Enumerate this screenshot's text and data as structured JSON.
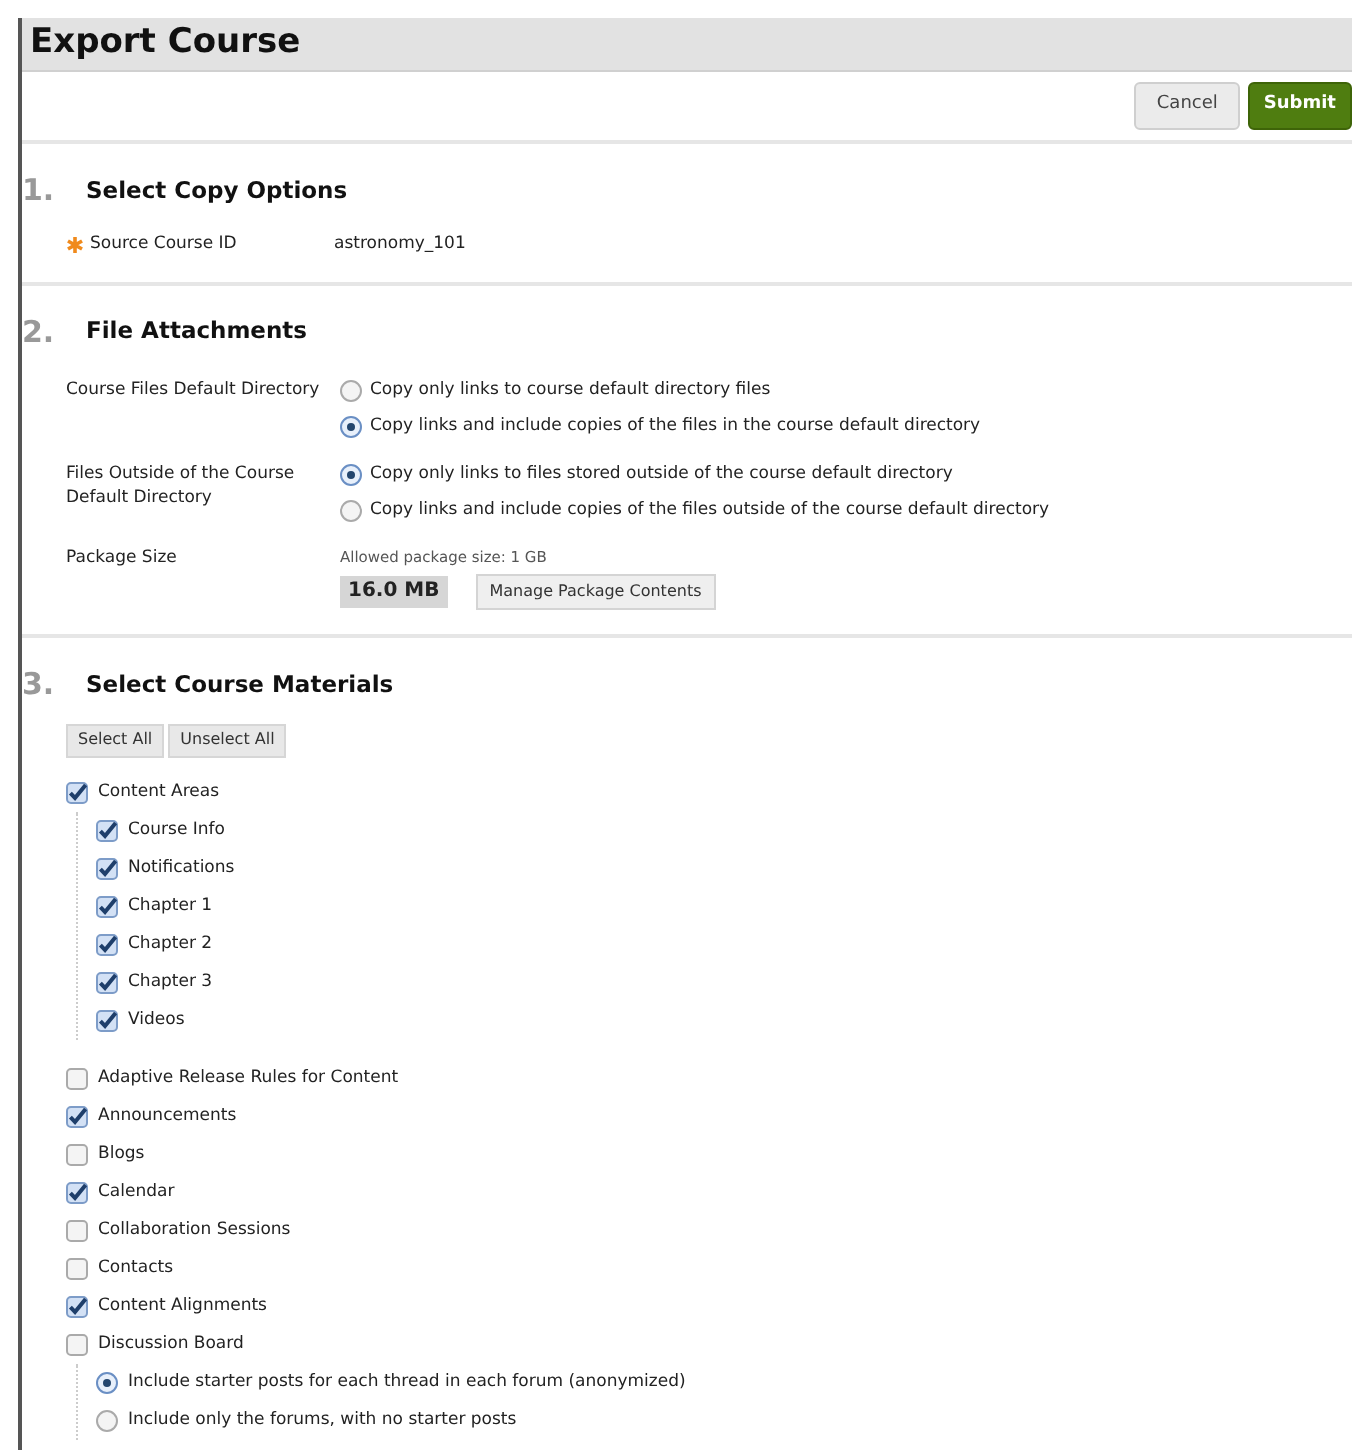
{
  "title": "Export Course",
  "buttons": [
    {
      "label": "Cancel",
      "kind": "secondary"
    },
    {
      "label": "Submit",
      "kind": "primary"
    }
  ],
  "sections": [
    {
      "number": "1.",
      "title": "Select Copy Options",
      "kind": "fields",
      "fields": [
        {
          "label": "Source Course ID",
          "value": "astronomy_101",
          "required": true
        }
      ]
    },
    {
      "number": "2.",
      "title": "File Attachments",
      "kind": "attachments",
      "groups": [
        {
          "label": "Course Files Default Directory",
          "options": [
            {
              "label": "Copy only links to course default directory files",
              "selected": false
            },
            {
              "label": "Copy links and include copies of the files in the course default directory",
              "selected": true
            }
          ]
        },
        {
          "label": "Files Outside of the Course Default Directory",
          "options": [
            {
              "label": "Copy only links to files stored outside of the course default directory",
              "selected": true
            },
            {
              "label": "Copy links and include copies of the files outside of the course default directory",
              "selected": false
            }
          ]
        }
      ],
      "package": {
        "label": "Package Size",
        "allowed": "Allowed package size:  1 GB",
        "size": "16.0 MB",
        "button": "Manage Package Contents"
      }
    },
    {
      "number": "3.",
      "title": "Select Course Materials",
      "kind": "materials",
      "buttons": [
        "Select All",
        "Unselect All"
      ],
      "items": [
        {
          "kind": "checkbox",
          "label": "Content Areas",
          "checked": true,
          "children": [
            {
              "kind": "checkbox",
              "label": "Course Info",
              "checked": true
            },
            {
              "kind": "checkbox",
              "label": "Notifications",
              "checked": true
            },
            {
              "kind": "checkbox",
              "label": "Chapter 1",
              "checked": true
            },
            {
              "kind": "checkbox",
              "label": "Chapter 2",
              "checked": true
            },
            {
              "kind": "checkbox",
              "label": "Chapter 3",
              "checked": true
            },
            {
              "kind": "checkbox",
              "label": "Videos",
              "checked": true
            }
          ]
        },
        {
          "kind": "checkbox",
          "label": "Adaptive Release Rules for Content",
          "checked": false
        },
        {
          "kind": "checkbox",
          "label": "Announcements",
          "checked": true
        },
        {
          "kind": "checkbox",
          "label": "Blogs",
          "checked": false
        },
        {
          "kind": "checkbox",
          "label": "Calendar",
          "checked": true
        },
        {
          "kind": "checkbox",
          "label": "Collaboration Sessions",
          "checked": false
        },
        {
          "kind": "checkbox",
          "label": "Contacts",
          "checked": false
        },
        {
          "kind": "checkbox",
          "label": "Content Alignments",
          "checked": true
        },
        {
          "kind": "checkbox",
          "label": "Discussion Board",
          "checked": false,
          "children": [
            {
              "kind": "radio",
              "label": "Include starter posts for each thread in each forum (anonymized)",
              "selected": true
            },
            {
              "kind": "radio",
              "label": "Include only the forums, with no starter posts",
              "selected": false
            }
          ]
        }
      ]
    }
  ]
}
